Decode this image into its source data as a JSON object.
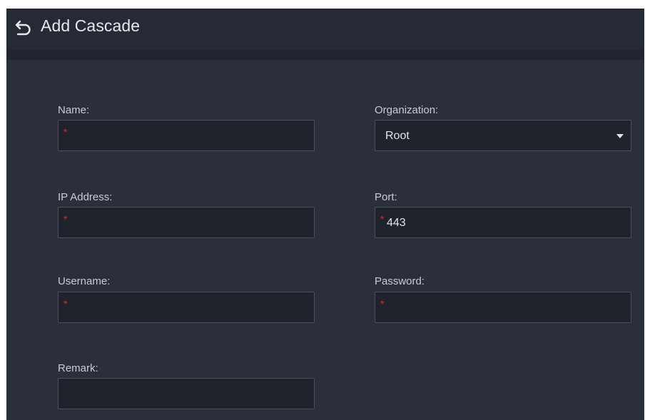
{
  "header": {
    "back_icon": "back-arrow-icon",
    "title": "Add Cascade"
  },
  "form": {
    "name": {
      "label": "Name:",
      "required_mark": "*",
      "value": ""
    },
    "organization": {
      "label": "Organization:",
      "selected": "Root",
      "icon": "caret-down-icon"
    },
    "ip_address": {
      "label": "IP Address:",
      "required_mark": "*",
      "value": ""
    },
    "port": {
      "label": "Port:",
      "required_mark": "*",
      "value": "443"
    },
    "username": {
      "label": "Username:",
      "required_mark": "*",
      "value": ""
    },
    "password": {
      "label": "Password:",
      "required_mark": "*",
      "value": ""
    },
    "remark": {
      "label": "Remark:",
      "value": ""
    }
  },
  "colors": {
    "panel": "#2b2f3c",
    "header": "#262a35",
    "field_bg": "#21232c",
    "field_border": "#4b4f5d",
    "required": "#e0252b",
    "text": "#e2e4ea"
  }
}
